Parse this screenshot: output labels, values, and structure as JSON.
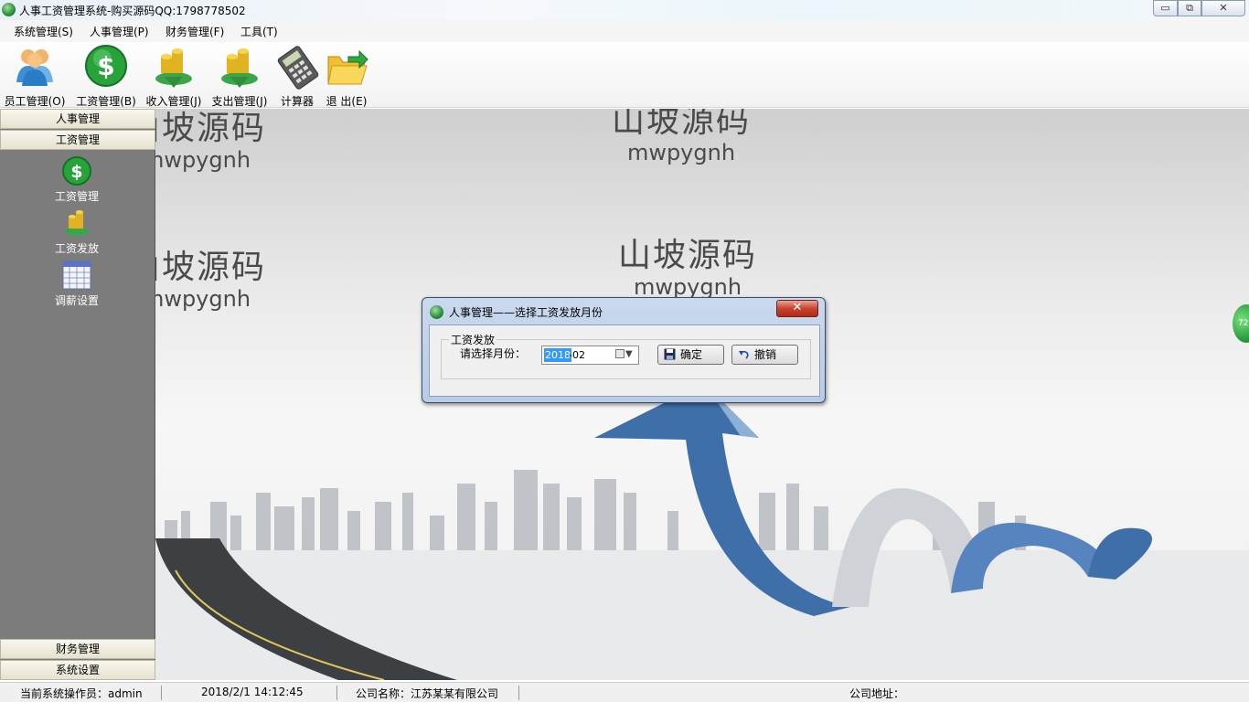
{
  "window": {
    "title": "人事工资管理系统-购买源码QQ:1798778502",
    "minimize_glyph": "▭",
    "maximize_glyph": "⧉",
    "close_glyph": "✕"
  },
  "menubar": {
    "items": [
      {
        "label": "系统管理(S)"
      },
      {
        "label": "人事管理(P)"
      },
      {
        "label": "财务管理(F)"
      },
      {
        "label": "工具(T)"
      }
    ]
  },
  "toolbar": {
    "items": [
      {
        "label": "员工管理(O)",
        "icon": "users-icon"
      },
      {
        "label": "工资管理(B)",
        "icon": "dollar-icon"
      },
      {
        "label": "收入管理(J)",
        "icon": "coins-in-icon"
      },
      {
        "label": "支出管理(J)",
        "icon": "coins-out-icon"
      },
      {
        "label": "计算器",
        "icon": "calculator-icon"
      },
      {
        "label": "退 出(E)",
        "icon": "folder-exit-icon"
      }
    ]
  },
  "sidebar": {
    "headers": [
      "人事管理",
      "工资管理",
      "财务管理",
      "系统设置"
    ],
    "items": [
      {
        "label": "工资管理",
        "icon": "dollar-icon"
      },
      {
        "label": "工资发放",
        "icon": "coins-in-icon"
      },
      {
        "label": "调薪设置",
        "icon": "calendar-grid-icon"
      }
    ]
  },
  "watermark": {
    "line1": "山坡源码",
    "line2": "mwpygnh"
  },
  "dialog": {
    "title": "人事管理——选择工资发放月份",
    "close_glyph": "✕",
    "group_label": "工资发放",
    "field_label": "请选择月份：",
    "date_value_selected": "2018",
    "date_value_rest": "-02",
    "dropdown_glyph": "▼",
    "ok_label": "确定",
    "cancel_label": "撤销"
  },
  "statusbar": {
    "operator": "当前系统操作员：admin",
    "datetime": "2018/2/1 14:12:45",
    "company": "公司名称：江苏某某有限公司",
    "address": "公司地址："
  },
  "edge_widget": {
    "text": "72"
  },
  "colors": {
    "sidebar_bg": "#7c7c7c",
    "accent_green": "#2c9b3e",
    "dialog_border": "#3a4d68",
    "arrow_blue": "#3f6fa8"
  }
}
